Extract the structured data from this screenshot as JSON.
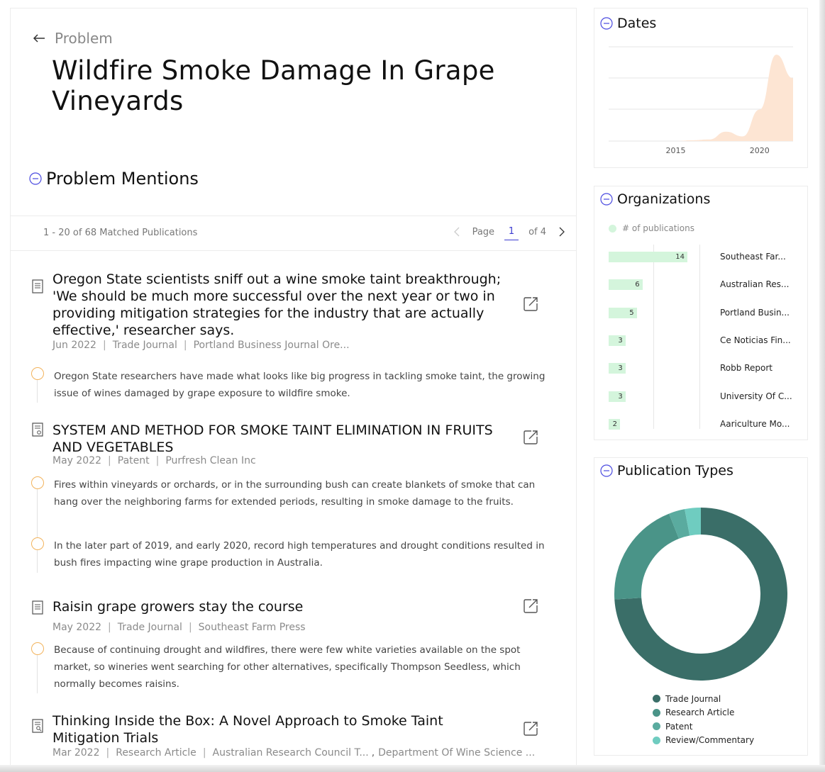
{
  "header": {
    "back_label": "Problem",
    "title": "Wildfire Smoke Damage In Grape Vineyards"
  },
  "mentions": {
    "section_title": "Problem Mentions",
    "match_count": "1 - 20 of 68 Matched Publications",
    "pager": {
      "page_label": "Page",
      "current_page": "1",
      "of_label": "of 4"
    },
    "results": [
      {
        "title": "Oregon State scientists sniff out a wine smoke taint breakthrough; 'We should be much more successful over the next year or two in providing mitigation strategies for the industry that are actually effective,' researcher says.",
        "date": "Jun 2022",
        "type": "Trade Journal",
        "source": "Portland Business Journal Ore...",
        "snippets": [
          "Oregon State researchers have made what looks like big progress in tackling smoke taint, the growing issue of wines damaged by grape exposure to wildfire smoke."
        ]
      },
      {
        "title": "SYSTEM AND METHOD FOR SMOKE TAINT ELIMINATION IN FRUITS AND VEGETABLES",
        "date": "May 2022",
        "type": "Patent",
        "source": "Purfresh Clean Inc",
        "snippets": [
          "Fires within vineyards or orchards, or in the surrounding bush can create blankets of smoke that can hang over the neighboring farms for extended periods, resulting in smoke damage to the fruits.",
          "In the later part of 2019, and early 2020, record high temperatures and drought conditions resulted in bush fires impacting wine grape production in Australia."
        ]
      },
      {
        "title": "Raisin grape growers stay the course",
        "date": "May 2022",
        "type": "Trade Journal",
        "source": "Southeast Farm Press",
        "snippets": [
          "Because of continuing drought and wildfires, there were few white varieties available on the spot market, so wineries went searching for other alternatives, specifically Thompson Seedless, which normally becomes raisins."
        ]
      },
      {
        "title": "Thinking Inside the Box: A Novel Approach to Smoke Taint Mitigation Trials",
        "date": "Mar 2022",
        "type": "Research Article",
        "source": "Australian Research Council T...",
        "source2": "Department Of Wine Science ..."
      }
    ]
  },
  "dates_card": {
    "title": "Dates",
    "accent": "#fde5d3"
  },
  "orgs_card": {
    "title": "Organizations",
    "legend": "# of publications",
    "bar_color": "#d4f5dc"
  },
  "pubtypes_card": {
    "title": "Publication Types"
  },
  "chart_data": [
    {
      "type": "area",
      "title": "Dates",
      "x_ticks": [
        "2015",
        "2020"
      ],
      "x": [
        2011,
        2012,
        2013,
        2014,
        2015,
        2016,
        2017,
        2018,
        2019,
        2020,
        2021,
        2022
      ],
      "values": [
        0,
        0,
        0,
        0,
        0,
        0.5,
        1,
        6,
        3,
        20,
        55,
        40
      ],
      "grid": true,
      "color": "#fde5d3"
    },
    {
      "type": "bar",
      "title": "Organizations",
      "legend": "# of publications",
      "categories": [
        "Southeast Far...",
        "Australian Res...",
        "Portland Busin...",
        "Ce Noticias Fin...",
        "Robb Report",
        "University Of C...",
        "Aariculture Mo..."
      ],
      "values": [
        14,
        6,
        5,
        3,
        3,
        3,
        2
      ],
      "orientation": "horizontal"
    },
    {
      "type": "pie",
      "title": "Publication Types",
      "donut": true,
      "categories": [
        "Trade Journal",
        "Research Article",
        "Patent",
        "Review/Commentary"
      ],
      "values": [
        74,
        20,
        3,
        3
      ],
      "colors": [
        "#3a6e68",
        "#4a9488",
        "#5aab9f",
        "#6fccc0"
      ],
      "legend": "bottom"
    }
  ]
}
